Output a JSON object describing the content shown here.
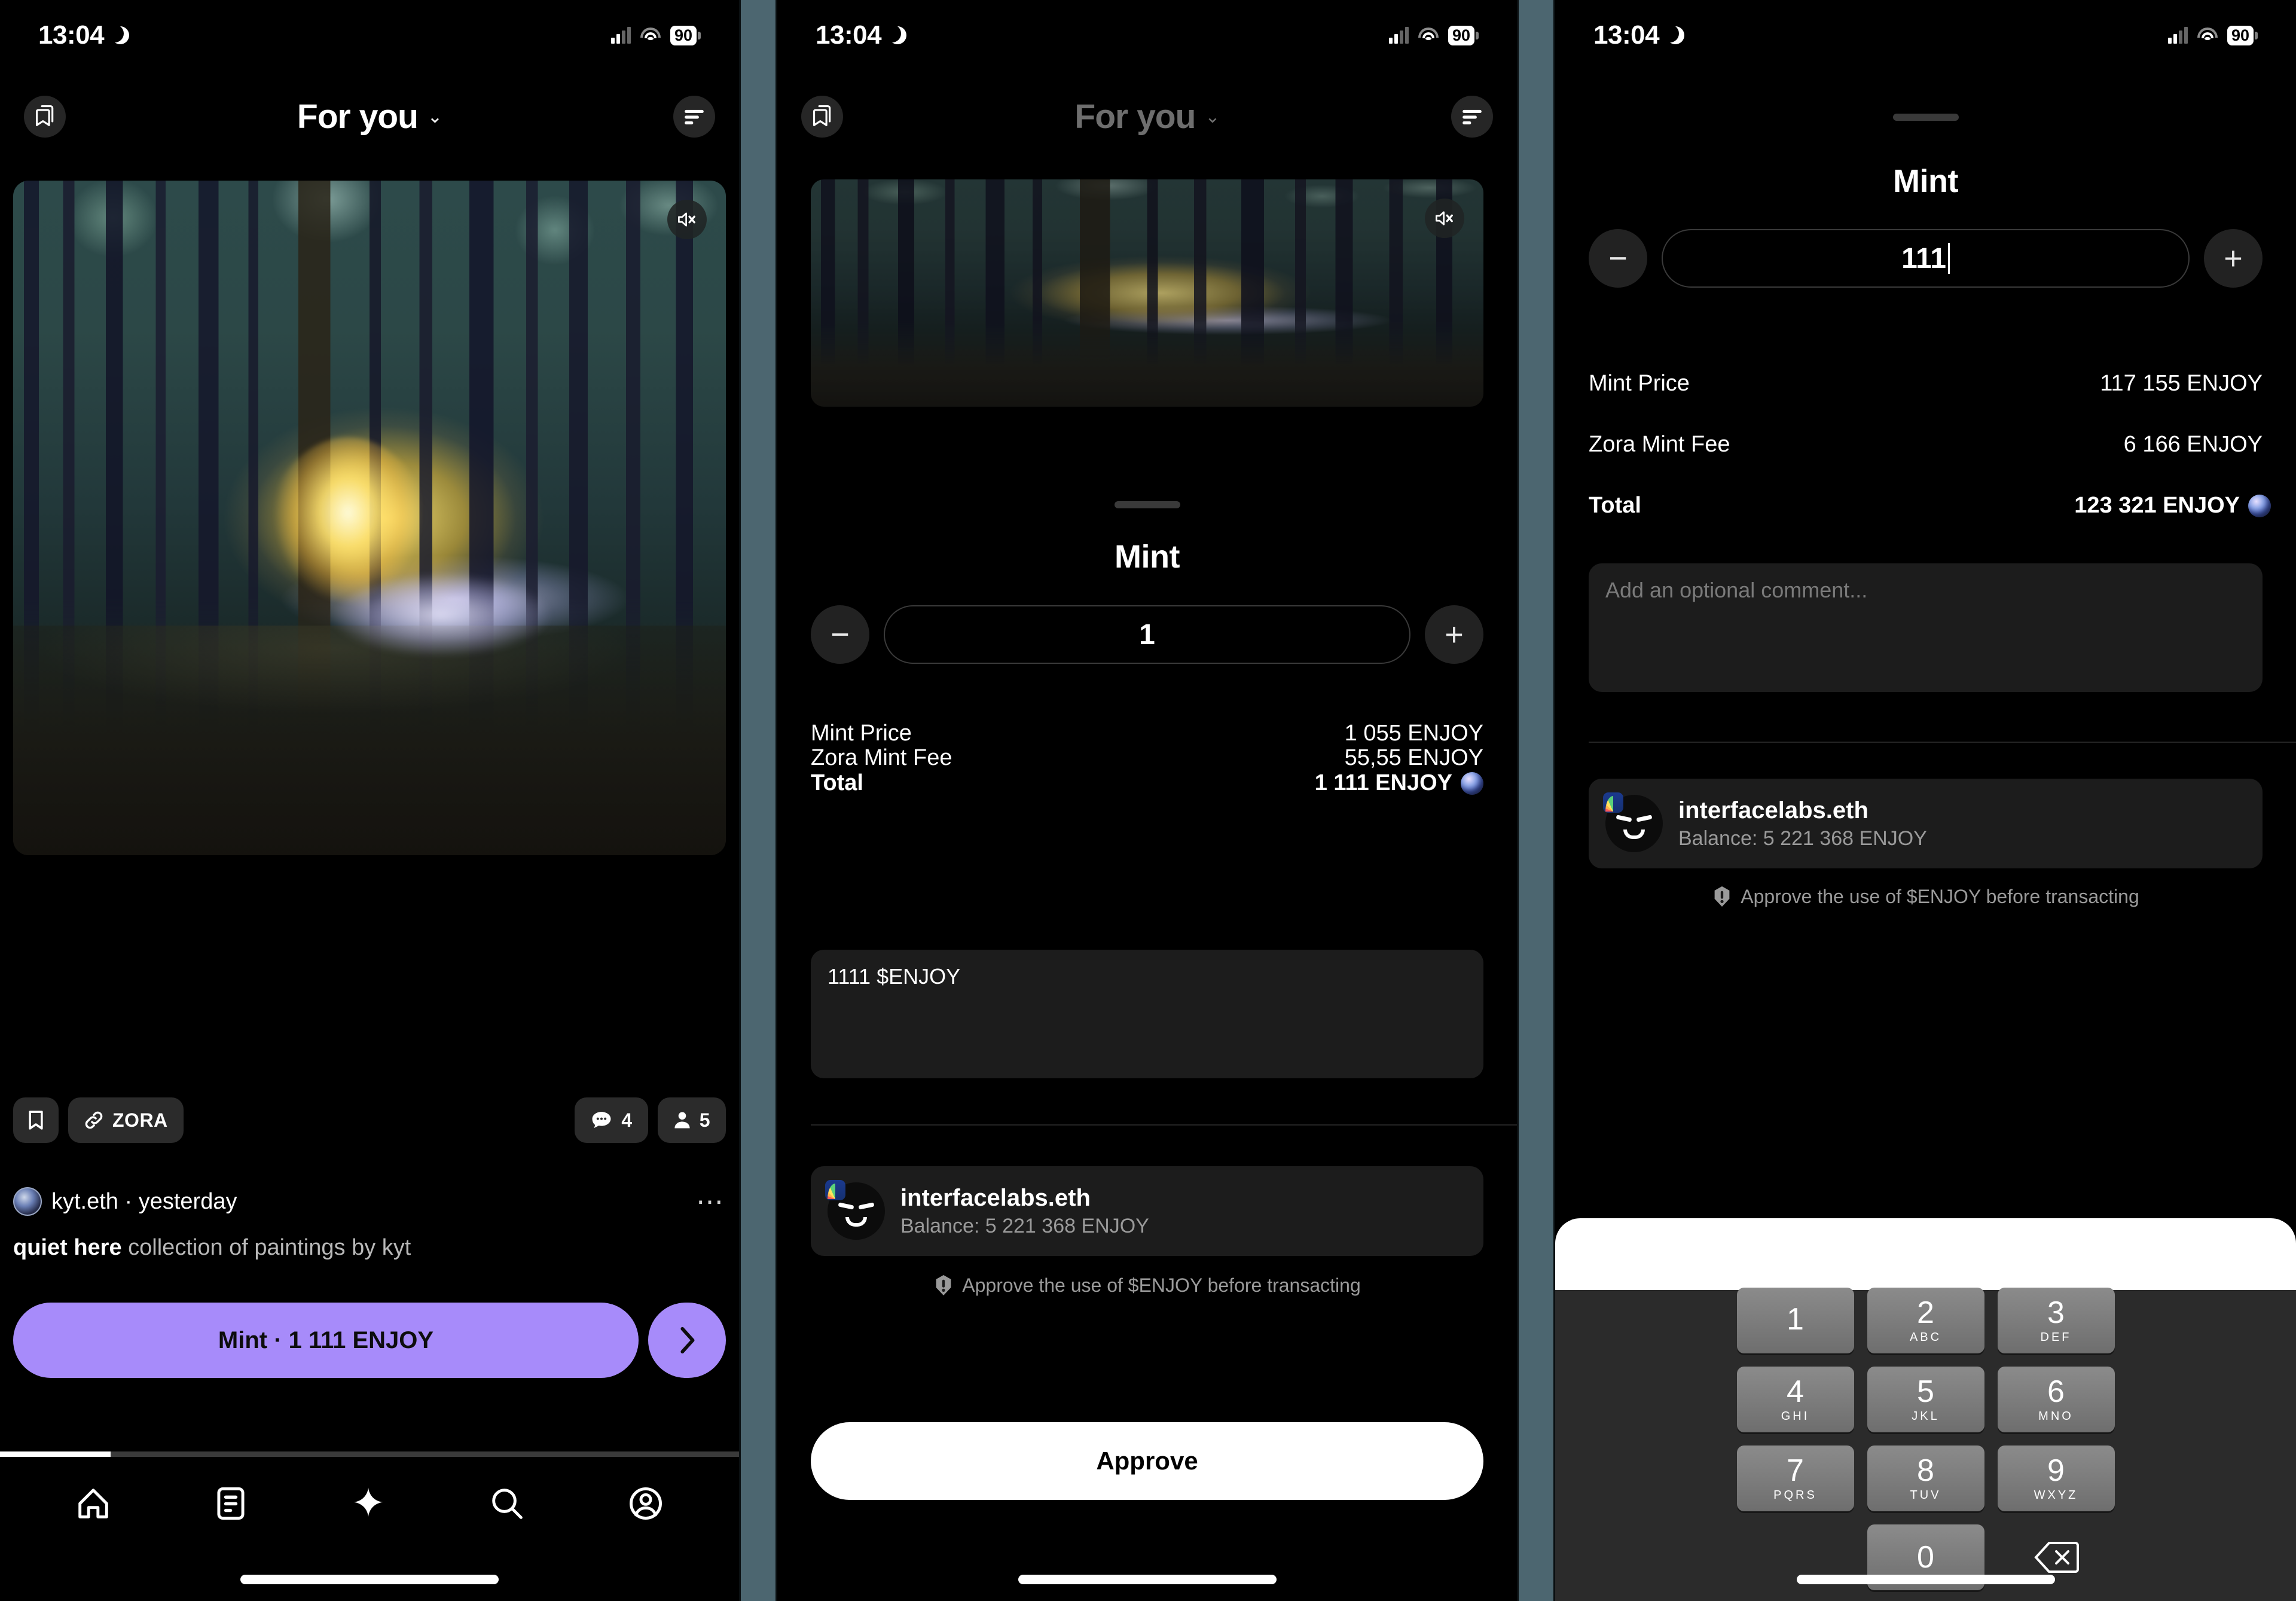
{
  "statusbar": {
    "time": "13:04",
    "battery": "90",
    "icons": {
      "moon": "crescent-moon-icon",
      "signal": "cellular-signal-icon",
      "wifi": "wifi-icon"
    }
  },
  "panel1": {
    "header": {
      "title": "For you",
      "chevron": "⌄",
      "bookmark_icon": "bookmark-icon",
      "filter_icon": "filter-icon"
    },
    "media": {
      "mute_icon": "mute-speaker-icon",
      "alt": "glowing ghost figure in a misty forest"
    },
    "actions": {
      "save_icon": "bookmark-icon",
      "source_label": "ZORA",
      "link_icon": "link-icon",
      "comment_icon": "comment-icon",
      "comment_count": "4",
      "collector_icon": "person-icon",
      "collector_count": "5"
    },
    "author": {
      "name": "kyt.eth · yesterday",
      "more_icon": "more-horizontal-icon"
    },
    "caption": {
      "title": "quiet here",
      "rest": " collection of paintings by kyt"
    },
    "cta": {
      "label": "Mint · 1 111 ENJOY",
      "next_icon": "chevron-right-icon"
    },
    "tabbar": [
      {
        "name": "home",
        "icon": "home-icon"
      },
      {
        "name": "feed",
        "icon": "list-icon"
      },
      {
        "name": "create",
        "icon": "sparkle-icon"
      },
      {
        "name": "search",
        "icon": "search-icon"
      },
      {
        "name": "profile",
        "icon": "account-icon"
      }
    ],
    "progress_percent": 15
  },
  "panel2": {
    "header": {
      "title": "For you",
      "chevron": "⌄",
      "bookmark_icon": "bookmark-icon",
      "filter_icon": "filter-icon"
    },
    "media": {
      "mute_icon": "mute-speaker-icon"
    },
    "sheet_title": "Mint",
    "stepper": {
      "minus": "−",
      "plus": "+",
      "quantity": "1"
    },
    "rows": [
      {
        "label": "Mint Price",
        "value": "1 055 ENJOY",
        "total": false
      },
      {
        "label": "Zora Mint Fee",
        "value": "55,55 ENJOY",
        "total": false
      },
      {
        "label": "Total",
        "value": "1 111 ENJOY",
        "total": true,
        "orb": true
      }
    ],
    "comment": {
      "value": "1111 $ENJOY",
      "placeholder": "Add an optional comment..."
    },
    "wallet": {
      "name": "interfacelabs.eth",
      "balance": "Balance: 5 221 368 ENJOY",
      "badge_icon": "rainbow-wallet-icon"
    },
    "approve_note": "Approve the use of $ENJOY before transacting",
    "approve_button": "Approve"
  },
  "panel3": {
    "sheet_title": "Mint",
    "stepper": {
      "minus": "−",
      "plus": "+",
      "quantity": "111"
    },
    "rows": [
      {
        "label": "Mint Price",
        "value": "117 155 ENJOY",
        "total": false
      },
      {
        "label": "Zora Mint Fee",
        "value": "6 166 ENJOY",
        "total": false
      },
      {
        "label": "Total",
        "value": "123 321 ENJOY",
        "total": true,
        "orb": true
      }
    ],
    "comment": {
      "value": "",
      "placeholder": "Add an optional comment..."
    },
    "wallet": {
      "name": "interfacelabs.eth",
      "balance": "Balance: 5 221 368 ENJOY",
      "badge_icon": "rainbow-wallet-icon"
    },
    "approve_note": "Approve the use of $ENJOY before transacting",
    "keyboard": {
      "keys": [
        {
          "num": "1",
          "alpha": ""
        },
        {
          "num": "2",
          "alpha": "ABC"
        },
        {
          "num": "3",
          "alpha": "DEF"
        },
        {
          "num": "4",
          "alpha": "GHI"
        },
        {
          "num": "5",
          "alpha": "JKL"
        },
        {
          "num": "6",
          "alpha": "MNO"
        },
        {
          "num": "7",
          "alpha": "PQRS"
        },
        {
          "num": "8",
          "alpha": "TUV"
        },
        {
          "num": "9",
          "alpha": "WXYZ"
        },
        {
          "num": "0",
          "alpha": ""
        }
      ],
      "delete_icon": "backspace-icon"
    }
  },
  "colors": {
    "accent_purple": "#a78bfa",
    "background": "#000000",
    "surface": "#1c1c1c",
    "divider": "#4c6670",
    "key_gray": "#7e7e7e"
  }
}
